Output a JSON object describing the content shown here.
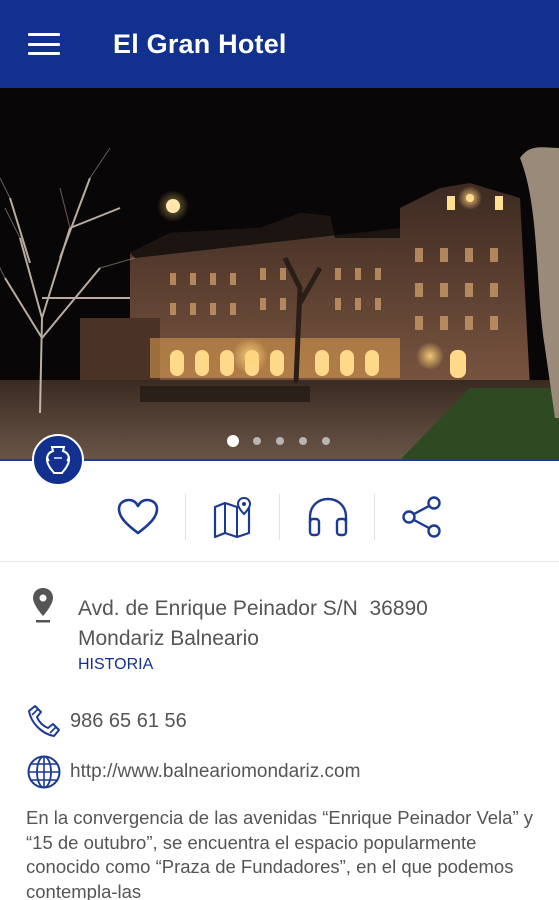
{
  "header": {
    "title": "El Gran Hotel",
    "menu_icon": "hamburger-menu-icon",
    "background": "#12318f"
  },
  "hero": {
    "slides_total": 5,
    "active_slide": 1
  },
  "actions": [
    {
      "name": "favorite",
      "icon": "heart-icon"
    },
    {
      "name": "map",
      "icon": "map-pin-icon"
    },
    {
      "name": "audio",
      "icon": "headphones-icon"
    },
    {
      "name": "share",
      "icon": "share-icon"
    }
  ],
  "location": {
    "address_line1": "Avd. de Enrique Peinador S/N  36890",
    "address_line2": "Mondariz Balneario",
    "category": "HISTORIA"
  },
  "contact": {
    "phone": "986 65 61 56",
    "website": "http://www.balneariomondariz.com"
  },
  "description": "En la convergencia de las avenidas “Enrique Peinador Vela” y “15 de outubro”, se encuentra el espacio popularmente conocido como “Praza de Fundadores”, en el que podemos contempla-las",
  "colors": {
    "accent": "#12318f",
    "text": "#555555"
  }
}
